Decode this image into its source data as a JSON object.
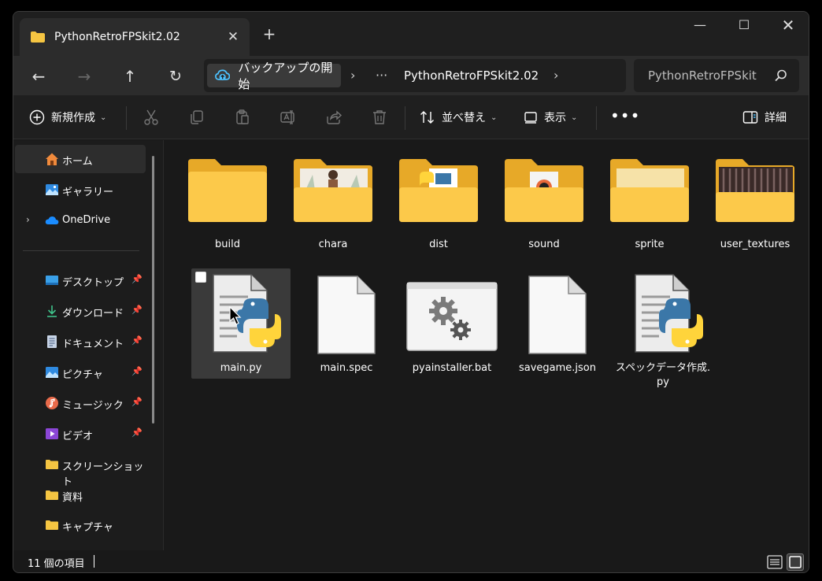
{
  "window": {
    "tab_title": "PythonRetroFPSkit2.02",
    "tab_close": "✕",
    "new_tab": "+",
    "minimize": "—",
    "maximize": "☐",
    "close": "✕"
  },
  "nav": {
    "back": "←",
    "forward": "→",
    "up": "↑",
    "refresh": "↻"
  },
  "address": {
    "backup_label": "バックアップの開始",
    "separator": "›",
    "more": "···",
    "current_folder": "PythonRetroFPSkit2.02"
  },
  "search": {
    "placeholder": "PythonRetroFPSkit"
  },
  "commands": {
    "new_label": "新規作成",
    "sort_label": "並べ替え",
    "view_label": "表示",
    "more": "•••",
    "details_label": "詳細"
  },
  "sidebar": {
    "items": [
      {
        "label": "ホーム"
      },
      {
        "label": "ギャラリー"
      },
      {
        "label": "OneDrive"
      },
      {
        "label": "デスクトップ"
      },
      {
        "label": "ダウンロード"
      },
      {
        "label": "ドキュメント"
      },
      {
        "label": "ピクチャ"
      },
      {
        "label": "ミュージック"
      },
      {
        "label": "ビデオ"
      },
      {
        "label": "スクリーンショット"
      },
      {
        "label": "資料"
      },
      {
        "label": "キャプチャ"
      }
    ]
  },
  "files": [
    {
      "name": "build",
      "type": "folder"
    },
    {
      "name": "chara",
      "type": "folder"
    },
    {
      "name": "dist",
      "type": "folder"
    },
    {
      "name": "sound",
      "type": "folder"
    },
    {
      "name": "sprite",
      "type": "folder"
    },
    {
      "name": "user_textures",
      "type": "folder"
    },
    {
      "name": "main.py",
      "type": "python"
    },
    {
      "name": "main.spec",
      "type": "file"
    },
    {
      "name": "pyainstaller.bat",
      "type": "bat"
    },
    {
      "name": "savegame.json",
      "type": "file"
    },
    {
      "name": "スペックデータ作成.py",
      "type": "python"
    }
  ],
  "status": {
    "item_count": "11 個の項目"
  },
  "colors": {
    "folder": "#f5c542",
    "accent": "#4cc2ff",
    "python_blue": "#3b77a8",
    "python_yellow": "#ffd43b"
  }
}
